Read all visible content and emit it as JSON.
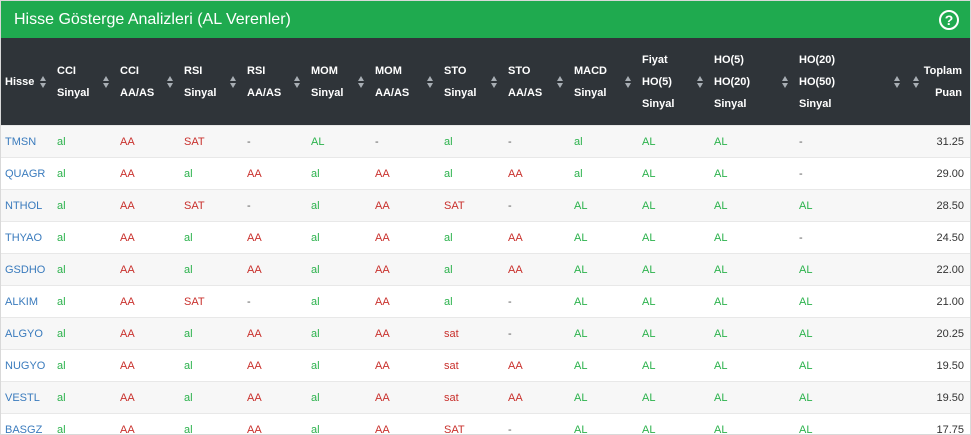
{
  "header": {
    "title": "Hisse Gösterge Analizleri (AL Verenler)",
    "help_glyph": "?"
  },
  "columns": [
    [
      "Hisse"
    ],
    [
      "CCI",
      "Sinyal"
    ],
    [
      "CCI",
      "AA/AS"
    ],
    [
      "RSI",
      "Sinyal"
    ],
    [
      "RSI",
      "AA/AS"
    ],
    [
      "MOM",
      "Sinyal"
    ],
    [
      "MOM",
      "AA/AS"
    ],
    [
      "STO",
      "Sinyal"
    ],
    [
      "STO",
      "AA/AS"
    ],
    [
      "MACD",
      "Sinyal"
    ],
    [
      "Fiyat",
      "HO(5)",
      "Sinyal"
    ],
    [
      "HO(5)",
      "HO(20)",
      "Sinyal"
    ],
    [
      "HO(20)",
      "HO(50)",
      "Sinyal"
    ],
    [
      "Toplam",
      "Puan"
    ]
  ],
  "rows": [
    [
      "TMSN",
      "al",
      "AA",
      "SAT",
      "-",
      "AL",
      "-",
      "al",
      "-",
      "al",
      "AL",
      "AL",
      "-",
      "31.25"
    ],
    [
      "QUAGR",
      "al",
      "AA",
      "al",
      "AA",
      "al",
      "AA",
      "al",
      "AA",
      "al",
      "AL",
      "AL",
      "-",
      "29.00"
    ],
    [
      "NTHOL",
      "al",
      "AA",
      "SAT",
      "-",
      "al",
      "AA",
      "SAT",
      "-",
      "AL",
      "AL",
      "AL",
      "AL",
      "28.50"
    ],
    [
      "THYAO",
      "al",
      "AA",
      "al",
      "AA",
      "al",
      "AA",
      "al",
      "AA",
      "AL",
      "AL",
      "AL",
      "-",
      "24.50"
    ],
    [
      "GSDHO",
      "al",
      "AA",
      "al",
      "AA",
      "al",
      "AA",
      "al",
      "AA",
      "AL",
      "AL",
      "AL",
      "AL",
      "22.00"
    ],
    [
      "ALKIM",
      "al",
      "AA",
      "SAT",
      "-",
      "al",
      "AA",
      "al",
      "-",
      "AL",
      "AL",
      "AL",
      "AL",
      "21.00"
    ],
    [
      "ALGYO",
      "al",
      "AA",
      "al",
      "AA",
      "al",
      "AA",
      "sat",
      "-",
      "AL",
      "AL",
      "AL",
      "AL",
      "20.25"
    ],
    [
      "NUGYO",
      "al",
      "AA",
      "al",
      "AA",
      "al",
      "AA",
      "sat",
      "AA",
      "AL",
      "AL",
      "AL",
      "AL",
      "19.50"
    ],
    [
      "VESTL",
      "al",
      "AA",
      "al",
      "AA",
      "al",
      "AA",
      "sat",
      "AA",
      "AL",
      "AL",
      "AL",
      "AL",
      "19.50"
    ],
    [
      "BASGZ",
      "al",
      "AA",
      "al",
      "AA",
      "al",
      "AA",
      "SAT",
      "-",
      "AL",
      "AL",
      "AL",
      "AL",
      "17.75"
    ]
  ],
  "colors": {
    "header_bg": "#1faa4f",
    "table_head_bg": "#2f3439",
    "positive": "#2bb24c",
    "negative": "#c9302c",
    "symbol": "#3a7bbd"
  }
}
